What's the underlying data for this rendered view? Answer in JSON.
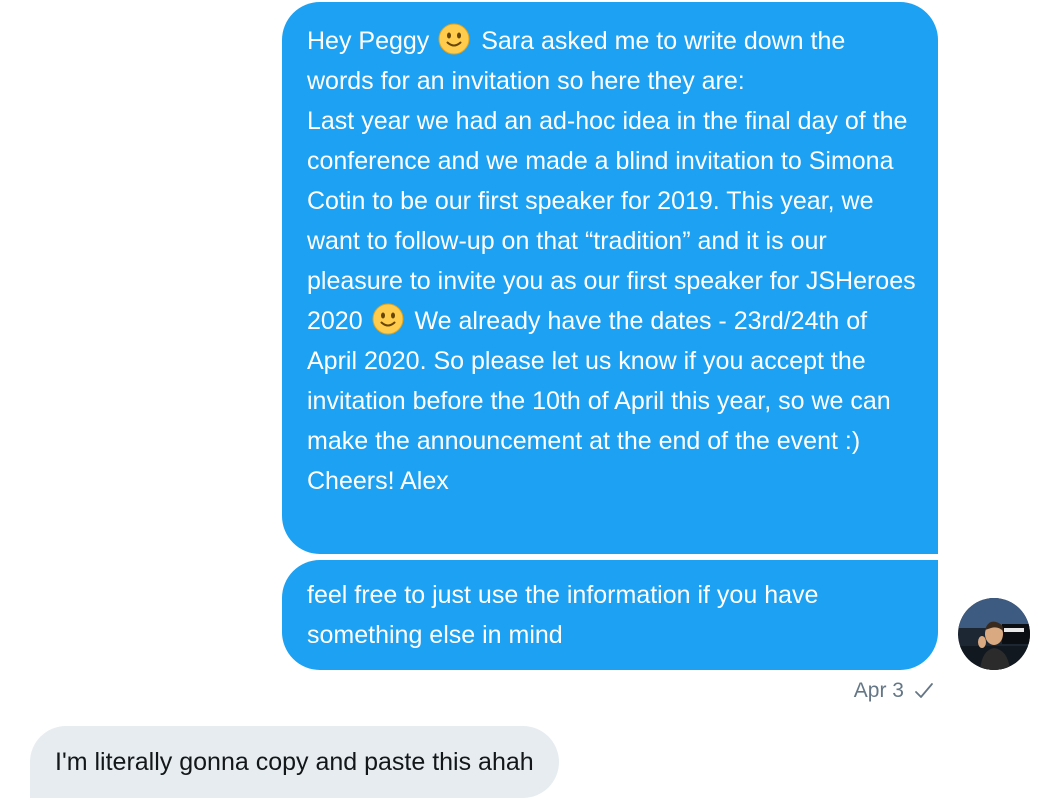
{
  "conversation": {
    "messages": [
      {
        "direction": "sent",
        "parts": [
          "Hey Peggy",
          "Sara asked me to write down the words for an invitation so here they are:",
          "Last year we had an ad-hoc idea in the final day of the conference and we made a blind invitation to Simona Cotin to be our first speaker for 2019. This year, we want to follow-up on that “tradition” and it is our pleasure to invite you as our first speaker for JSHeroes 2020",
          "We already have the dates - 23rd/24th of April 2020. So please let us know if you accept the invitation before the 10th of April this year, so we can make the announcement at the end of the event :) Cheers! Alex"
        ],
        "emoji_icon": "slightly-smiling-face-icon"
      },
      {
        "direction": "sent",
        "text": "feel free to just use the information if you have something else in mind"
      },
      {
        "direction": "received",
        "text": "I'm literally gonna copy and paste this ahah"
      }
    ],
    "timestamp": "Apr 3",
    "status_icon": "check-icon",
    "avatar_icon": "sender-avatar"
  },
  "colors": {
    "sent_bubble": "#1da1f2",
    "received_bubble": "#e6ecf0",
    "timestamp_text": "#657786"
  }
}
